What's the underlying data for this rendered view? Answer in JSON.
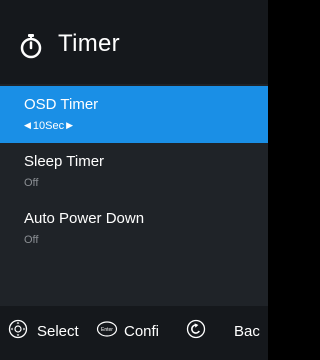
{
  "header": {
    "title": "Timer",
    "icon": "stopwatch-icon"
  },
  "menu": {
    "items": [
      {
        "label": "OSD Timer",
        "value": "10Sec",
        "selected": true
      },
      {
        "label": "Sleep Timer",
        "value": "Off",
        "selected": false
      },
      {
        "label": "Auto Power Down",
        "value": "Off",
        "selected": false
      }
    ]
  },
  "footer": {
    "select": {
      "label": "Select",
      "icon": "dpad-icon"
    },
    "confirm": {
      "label": "Confi",
      "icon": "enter-icon",
      "icon_text": "Enter"
    },
    "back": {
      "label": "Bac",
      "icon": "back-icon"
    }
  },
  "colors": {
    "accent": "#1a8fe6",
    "panel": "#1f2328",
    "header": "#15181c",
    "muted_text": "#8b8f94"
  }
}
